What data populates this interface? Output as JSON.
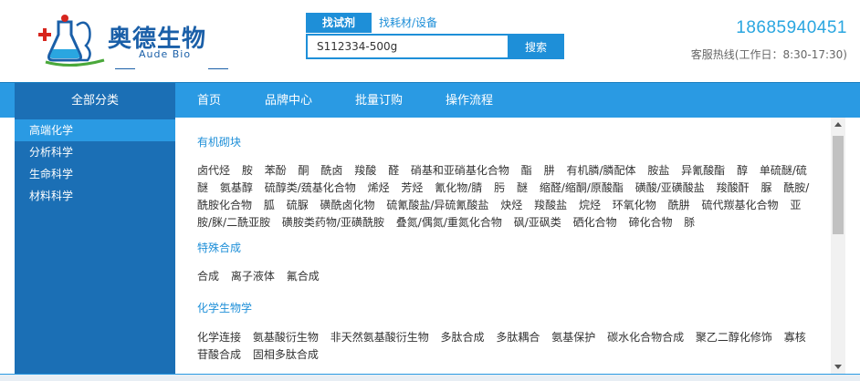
{
  "header": {
    "logo_text": "奥德生物",
    "logo_sub": "Aude Bio",
    "phone": "18685940451",
    "hotline": "客服热线(工作日：8:30-17:30)"
  },
  "search": {
    "tabs": [
      "找试剂",
      "找耗材/设备"
    ],
    "value": "S112334-500g",
    "button": "搜索"
  },
  "nav": {
    "all_categories": "全部分类",
    "items": [
      "首页",
      "品牌中心",
      "批量订购",
      "操作流程"
    ]
  },
  "sidebar": {
    "items": [
      {
        "label": "高端化学",
        "active": true
      },
      {
        "label": "分析科学",
        "active": false
      },
      {
        "label": "生命科学",
        "active": false
      },
      {
        "label": "材料科学",
        "active": false
      }
    ]
  },
  "content": {
    "sections": [
      {
        "title": "有机砌块",
        "tags": [
          "卤代烃",
          "胺",
          "苯酚",
          "酮",
          "酰卤",
          "羧酸",
          "醛",
          "硝基和亚硝基化合物",
          "酯",
          "肼",
          "有机膦/膦配体",
          "胺盐",
          "异氰酸酯",
          "醇",
          "单硫醚/硫醚",
          "氨基醇",
          "硫醇类/巯基化合物",
          "烯烃",
          "芳烃",
          "氰化物/腈",
          "肟",
          "醚",
          "缩醛/缩酮/原酸酯",
          "磺酸/亚磺酸盐",
          "羧酸酐",
          "脲",
          "酰胺/酰胺化合物",
          "胍",
          "硫脲",
          "磺酰卤化物",
          "硫氰酸盐/异硫氰酸盐",
          "炔烃",
          "羧酸盐",
          "烷烃",
          "环氧化物",
          "酰肼",
          "硫代羰基化合物",
          "亚胺/脒/二酰亚胺",
          "磺胺类药物/亚磺酰胺",
          "叠氮/偶氮/重氮化合物",
          "砜/亚砜类",
          "硒化合物",
          "碲化合物",
          "脎"
        ]
      },
      {
        "title": "特殊合成",
        "tags": [
          "合成",
          "离子液体",
          "氟合成"
        ]
      },
      {
        "title": "化学生物学",
        "tags": [
          "化学连接",
          "氨基酸衍生物",
          "非天然氨基酸衍生物",
          "多肽合成",
          "多肽耦合",
          "氨基保护",
          "碳水化合物合成",
          "聚乙二醇化修饰",
          "寡核苷酸合成",
          "固相多肽合成"
        ]
      }
    ]
  },
  "colors": {
    "brand_blue": "#1a5fa8",
    "accent_blue": "#2a9ae3",
    "dark_blue": "#1b6fb5"
  }
}
